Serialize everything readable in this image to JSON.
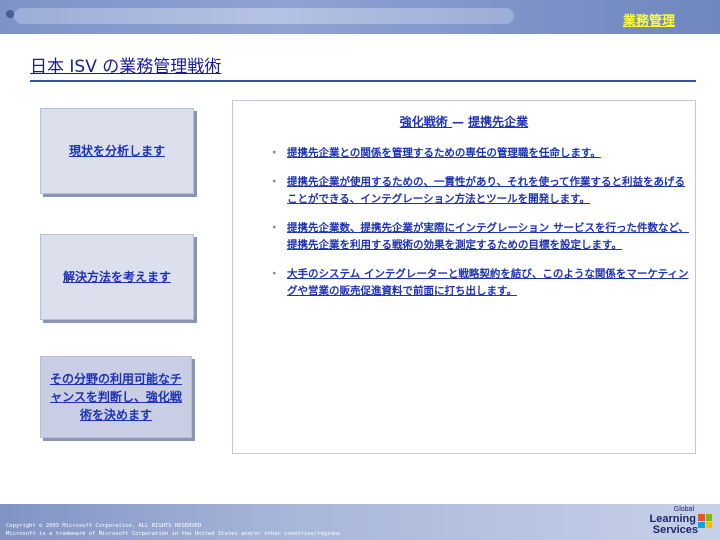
{
  "header": {
    "section": "業務管理"
  },
  "page": {
    "title": "日本 ISV の業務管理戦術"
  },
  "steps": [
    {
      "label": "現状を分析します"
    },
    {
      "label": "解決方法を考えます"
    },
    {
      "label": "その分野の利用可能なチャンスを判断し、強化戦術を決めます"
    }
  ],
  "panel": {
    "heading_part1": "強化戦術 ",
    "heading_sep": "— ",
    "heading_part2": "提携先企業",
    "bullet_mark": "・",
    "bullets": [
      "提携先企業との関係を管理するための専任の管理職を任命します。",
      "提携先企業が使用するための、一貫性があり、それを使って作業すると利益をあげることができる、インテグレーション方法とツールを開発します。",
      "提携先企業数、提携先企業が実際にインテグレーション サービスを行った件数など、提携先企業を利用する戦術の効果を測定するための目標を設定します。",
      "大手のシステム インテグレーターと戦略契約を結び、このような関係をマーケティングや営業の販売促進資料で前面に打ち出します。"
    ]
  },
  "footer": {
    "copyright_line1": "Copyright © 2003 Microsoft Corporation. ALL RIGHTS RESERVED",
    "copyright_line2": "Microsoft is a trademark of Microsoft Corporation in the United States and/or other countries/regions",
    "logo_line1": "Global",
    "logo_line2": "Learning",
    "logo_line3": "Services"
  },
  "colors": {
    "accent": "#1f33b5",
    "title": "#1a1a9a",
    "section": "#ffff33",
    "box": "#dcdfec"
  }
}
